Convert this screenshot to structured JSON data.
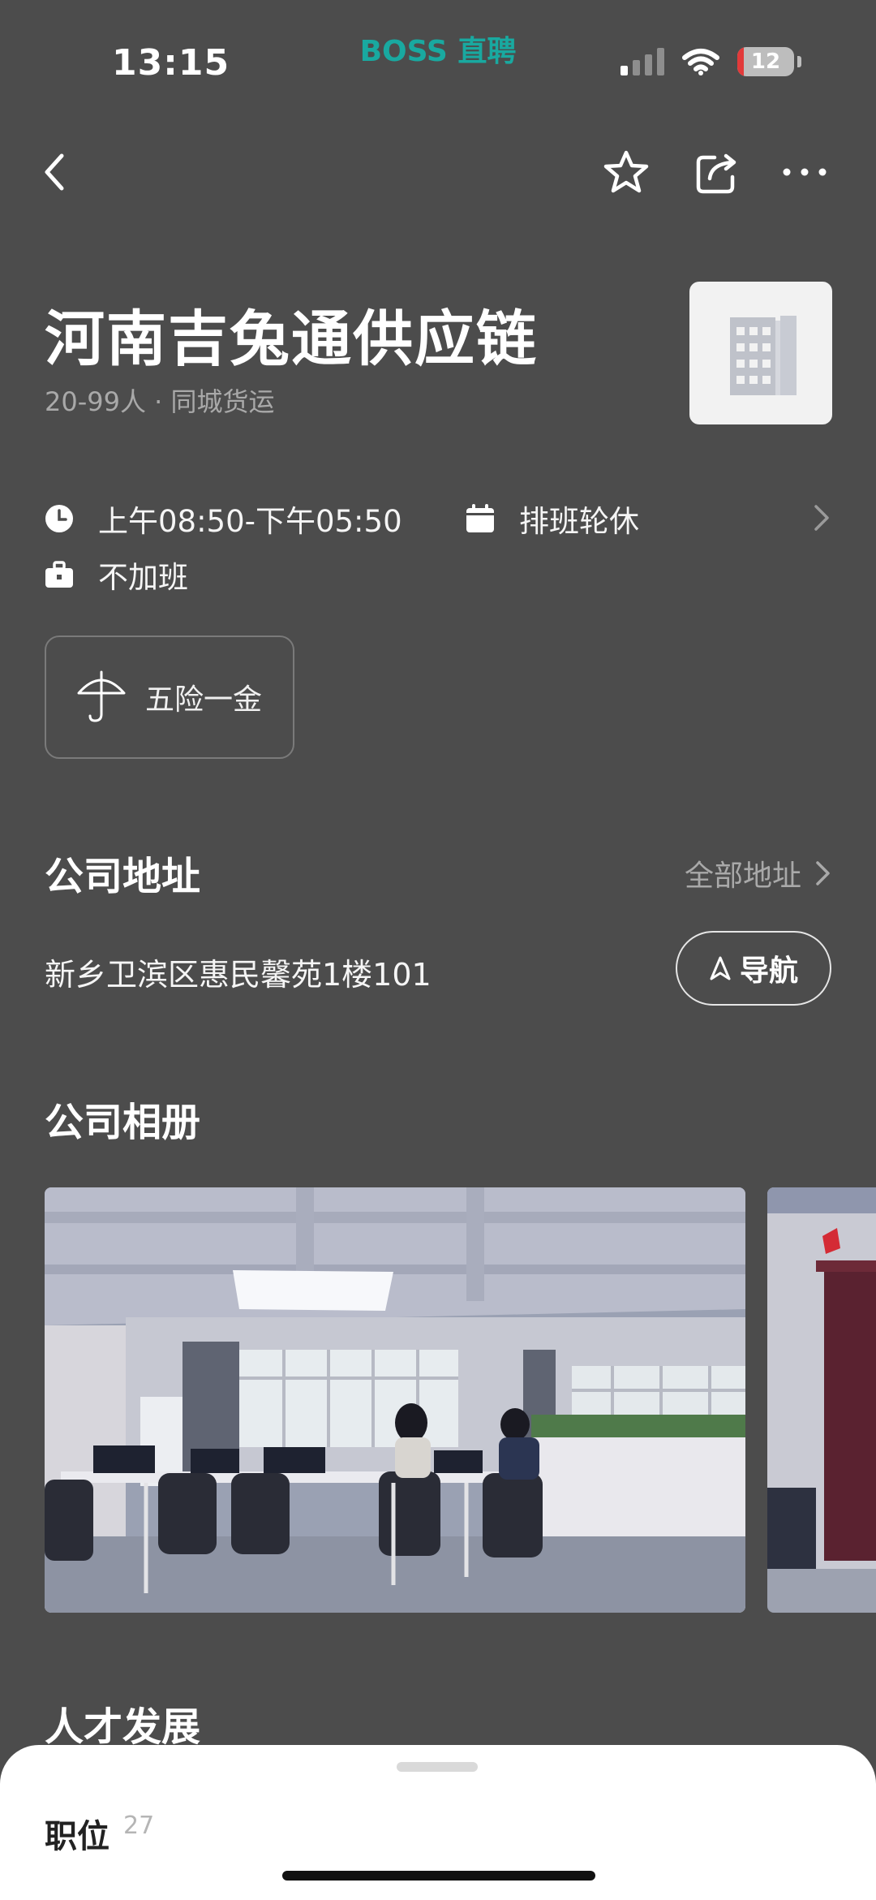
{
  "status_bar": {
    "time": "13:15",
    "app_brand": "BOSS 直聘",
    "battery_level": "12",
    "battery_fraction": 0.12,
    "signal_bars_active": 1,
    "signal_bars_total": 4
  },
  "nav": {
    "back_icon": "chevron-left-icon",
    "favorite_icon": "star-icon",
    "share_icon": "share-icon",
    "more_icon": "more-icon"
  },
  "company": {
    "name": "河南吉兔通供应链",
    "meta": "20-99人 · 同城货运",
    "logo_icon": "building-icon"
  },
  "work_info": {
    "hours": "上午08:50-下午05:50",
    "schedule": "排班轮休",
    "overtime": "不加班"
  },
  "welfare": {
    "label": "五险一金",
    "icon": "umbrella-icon"
  },
  "address_section": {
    "title": "公司地址",
    "all_link": "全部地址",
    "address": "新乡卫滨区惠民馨苑1楼101",
    "navigate_label": "导航"
  },
  "album_section": {
    "title": "公司相册"
  },
  "talent_section": {
    "title": "人才发展"
  },
  "bottom_sheet": {
    "jobs_label": "职位",
    "jobs_count": "27"
  },
  "colors": {
    "background": "#4c4c4c",
    "brand": "#19a9a0",
    "sheet": "#ffffff"
  }
}
